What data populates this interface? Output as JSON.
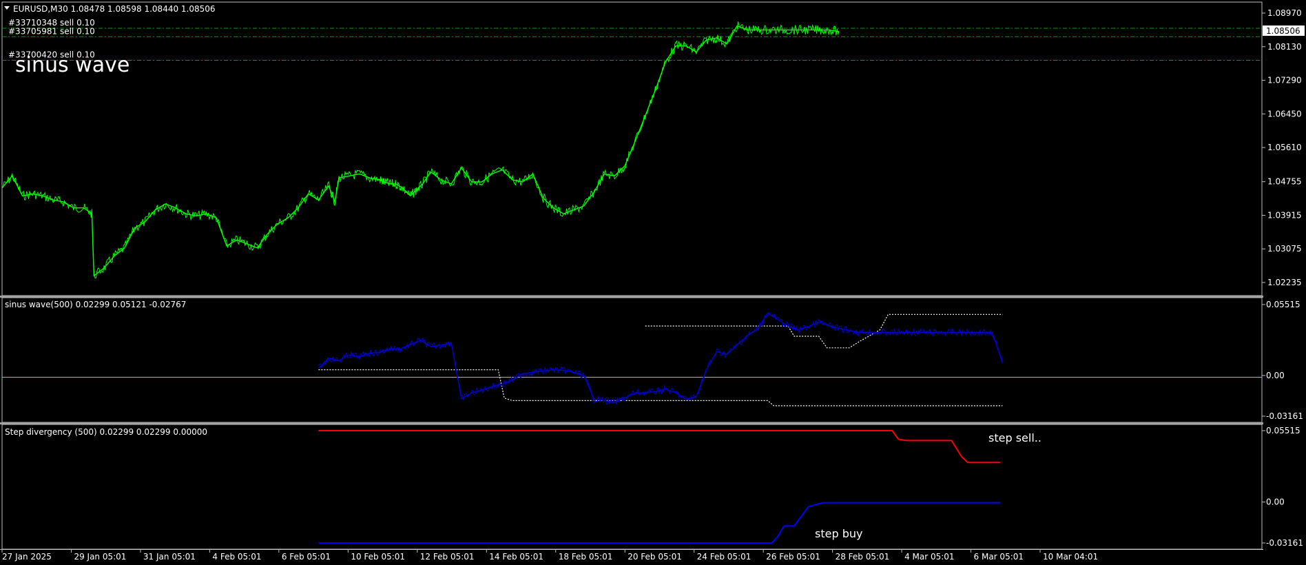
{
  "colors": {
    "background": "#000000",
    "price": "#00ff00",
    "sinus": "#0000d0",
    "level": "#ffffff",
    "zero": "#e5b400",
    "sell": "#ff0000",
    "buy": "#0000ff",
    "order_line": "#00a000",
    "frame": "#c0c0c0",
    "separator": "#a0a0a0"
  },
  "main": {
    "dropdown_icon": "triangle-down-icon",
    "header": "EURUSD,M30  1.08478 1.08598 1.08440 1.08506",
    "chart_label": "sinus wave",
    "current_price": "1.08506",
    "orders": [
      {
        "label": "#33710348 sell 0.10",
        "price": 1.0859
      },
      {
        "label": "#33705981 sell 0.10",
        "price": 1.0838
      },
      {
        "label": "#33700420 sell 0.10",
        "price": 1.0779
      }
    ],
    "y_ticks": [
      "1.08970",
      "1.08130",
      "1.07290",
      "1.06450",
      "1.05610",
      "1.04755",
      "1.03915",
      "1.03075",
      "1.02235"
    ]
  },
  "sinus_panel": {
    "header": "sinus wave(500) 0.02299 0.05121 -0.02767",
    "y_ticks": [
      "0.05515",
      "0.00",
      "-0.03161"
    ]
  },
  "step_panel": {
    "header": "Step divergency (500) 0.02299 0.02299 0.00000",
    "y_ticks": [
      "0.05515",
      "0.00",
      "-0.03161"
    ],
    "annotation_sell": "step sell..",
    "annotation_buy": "step buy"
  },
  "x_axis": [
    "27 Jan 2025",
    "29 Jan 05:01",
    "31 Jan 05:01",
    "4 Feb 05:01",
    "6 Feb 05:01",
    "10 Feb 05:01",
    "12 Feb 05:01",
    "14 Feb 05:01",
    "18 Feb 05:01",
    "20 Feb 05:01",
    "24 Feb 05:01",
    "26 Feb 05:01",
    "28 Feb 05:01",
    "4 Mar 05:01",
    "6 Mar 05:01",
    "10 Mar 04:01"
  ],
  "chart_data": [
    {
      "type": "line",
      "title": "EURUSD,M30",
      "series": [
        {
          "name": "EURUSD,M30",
          "x": [
            0.0,
            0.5,
            1.0,
            1.5,
            2.0,
            2.5,
            3.0,
            3.5,
            4.0,
            4.4,
            4.5,
            5.0,
            5.5,
            6.0,
            6.5,
            7.0,
            7.5,
            8.0,
            8.5,
            9.0,
            9.5,
            10.0,
            10.5,
            11.0,
            11.5,
            12.0,
            12.5,
            13.0,
            13.5,
            14.0,
            14.5,
            15.0,
            15.5,
            16.0,
            16.3,
            16.5,
            17.0,
            17.5,
            18.0,
            18.5,
            18.7,
            19.0,
            19.3,
            19.6,
            20.0,
            20.3,
            20.6,
            21.0,
            21.5,
            22.0,
            22.5,
            23.0,
            23.5,
            24.0,
            24.5,
            25.0,
            25.5,
            26.0,
            26.5,
            27.0,
            27.5,
            28.0,
            28.5,
            29.0,
            29.5,
            30.0,
            30.5,
            31.0,
            31.5,
            32.0,
            32.5,
            33.0,
            33.5,
            34.0,
            34.5,
            35.0,
            35.5,
            36.0,
            36.5,
            37.0,
            37.5,
            38.0,
            38.5,
            39.0,
            39.5,
            40.0,
            40.5,
            41.0
          ],
          "y": [
            1.046,
            1.049,
            1.044,
            1.0445,
            1.044,
            1.043,
            1.0425,
            1.041,
            1.041,
            1.0395,
            1.024,
            1.026,
            1.029,
            1.031,
            1.036,
            1.0375,
            1.0405,
            1.042,
            1.041,
            1.0395,
            1.039,
            1.0395,
            1.0385,
            1.0315,
            1.033,
            1.032,
            1.031,
            1.0345,
            1.037,
            1.0385,
            1.041,
            1.0445,
            1.043,
            1.0465,
            1.0425,
            1.0485,
            1.049,
            1.0495,
            1.0485,
            1.048,
            1.0475,
            1.047,
            1.047,
            1.046,
            1.044,
            1.0455,
            1.047,
            1.05,
            1.048,
            1.047,
            1.051,
            1.0475,
            1.0475,
            1.0495,
            1.0505,
            1.048,
            1.0475,
            1.0495,
            1.0435,
            1.041,
            1.0395,
            1.0405,
            1.0415,
            1.045,
            1.0495,
            1.049,
            1.0515,
            1.0575,
            1.064,
            1.0705,
            1.0775,
            1.0815,
            1.0815,
            1.08,
            1.083,
            1.0835,
            1.082,
            1.0865,
            1.0855,
            1.0855,
            1.0855,
            1.0855,
            1.0855,
            1.0855,
            1.0855,
            1.0855,
            1.0855,
            1.08506
          ]
        }
      ]
    },
    {
      "type": "line",
      "title": "sinus wave(500)",
      "ylim": [
        -0.03161,
        0.05515
      ],
      "series": [
        {
          "name": "sinus wave",
          "x": [
            15.5,
            16.0,
            16.5,
            17.0,
            17.5,
            18.0,
            18.5,
            19.0,
            19.5,
            20.0,
            20.5,
            21.0,
            21.5,
            22.0,
            22.5,
            23.0,
            23.5,
            24.0,
            24.5,
            25.0,
            25.5,
            26.0,
            26.5,
            27.0,
            27.5,
            28.0,
            28.5,
            29.0,
            29.5,
            30.0,
            30.5,
            31.0,
            31.5,
            32.0,
            32.5,
            33.0,
            33.5,
            34.0,
            34.5,
            35.0,
            35.5,
            36.0,
            36.5,
            37.0,
            37.5,
            38.0,
            38.5,
            39.0,
            39.5,
            40.0,
            40.5,
            41.0,
            41.5,
            42.0,
            42.5,
            43.0,
            43.5,
            44.0,
            44.5,
            45.0,
            45.5,
            46.0,
            46.5,
            47.0,
            47.5,
            48.0,
            48.5,
            49.0
          ],
          "y": [
            0.0055,
            0.0135,
            0.0115,
            0.016,
            0.0145,
            0.0175,
            0.018,
            0.021,
            0.0205,
            0.024,
            0.0275,
            0.0225,
            0.0235,
            0.0255,
            -0.018,
            -0.0135,
            -0.0115,
            -0.0085,
            -0.0065,
            -0.0035,
            0.0015,
            0.0025,
            0.0035,
            0.0045,
            0.004,
            0.0025,
            0.0,
            -0.0185,
            -0.0195,
            -0.021,
            -0.0175,
            -0.0135,
            -0.0135,
            -0.0125,
            -0.0105,
            -0.0135,
            -0.0185,
            -0.0165,
            0.0045,
            0.0185,
            0.0165,
            0.0235,
            0.031,
            0.036,
            0.0485,
            0.0435,
            0.0385,
            0.0355,
            0.038,
            0.0415,
            0.0385,
            0.0365,
            0.035,
            0.0335,
            0.0335,
            0.0335,
            0.0335,
            0.0335,
            0.0335,
            0.0335,
            0.0335,
            0.0335,
            0.0335,
            0.0335,
            0.0335,
            0.0335,
            0.0335,
            0.0095
          ]
        },
        {
          "name": "upper level",
          "x": [
            31.5,
            38.5,
            38.8,
            40.0,
            40.4,
            41.5,
            42.0,
            43.0,
            43.4,
            49.0
          ],
          "y": [
            0.0385,
            0.0385,
            0.0305,
            0.0305,
            0.0215,
            0.0215,
            0.0265,
            0.0355,
            0.0475,
            0.0475
          ]
        },
        {
          "name": "lower level",
          "x": [
            15.5,
            24.3,
            24.6,
            25.0,
            34.0,
            37.5,
            37.8,
            49.0
          ],
          "y": [
            0.0045,
            0.0045,
            -0.0175,
            -0.0195,
            -0.0195,
            -0.0195,
            -0.0235,
            -0.0235
          ]
        }
      ],
      "zero_line": 0.0
    },
    {
      "type": "line",
      "title": "Step divergency (500)",
      "ylim": [
        -0.03161,
        0.05515
      ],
      "series": [
        {
          "name": "step sell",
          "x": [
            15.5,
            43.6,
            43.9,
            44.3,
            46.5,
            47.0,
            47.3,
            48.9
          ],
          "y": [
            0.05515,
            0.05515,
            0.0485,
            0.0475,
            0.0475,
            0.035,
            0.0305,
            0.0305
          ]
        },
        {
          "name": "step buy",
          "x": [
            15.5,
            37.7,
            38.0,
            38.3,
            38.8,
            39.5,
            40.2,
            48.9
          ],
          "y": [
            -0.03161,
            -0.03161,
            -0.0265,
            -0.0185,
            -0.0185,
            -0.0035,
            -0.0005,
            -0.0005
          ]
        }
      ]
    }
  ]
}
